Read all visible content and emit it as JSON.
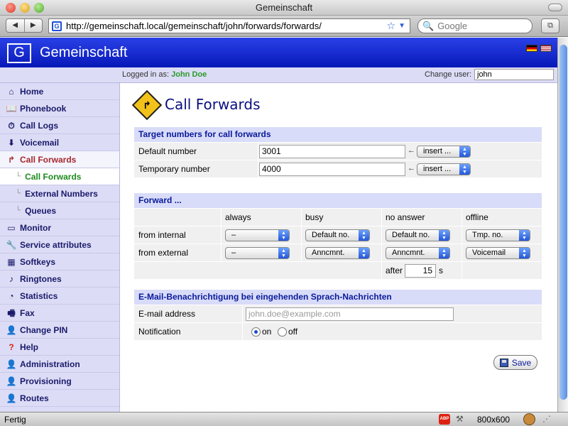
{
  "window": {
    "title": "Gemeinschaft"
  },
  "browser": {
    "url": "http://gemeinschaft.local/gemeinschaft/john/forwards/forwards/",
    "back": "◀",
    "forward": "▶",
    "search_placeholder": "Google"
  },
  "app": {
    "logo_glyph": "G",
    "title": "Gemeinschaft",
    "logged_in_label": "Logged in as:",
    "logged_in_user": "John Doe",
    "change_user_label": "Change user:",
    "change_user_value": "john"
  },
  "sidebar": {
    "items": [
      {
        "label": "Home",
        "icon": "home-icon"
      },
      {
        "label": "Phonebook",
        "icon": "phonebook-icon"
      },
      {
        "label": "Call Logs",
        "icon": "call-logs-icon"
      },
      {
        "label": "Voicemail",
        "icon": "voicemail-icon"
      },
      {
        "label": "Call Forwards",
        "icon": "call-forwards-icon"
      },
      {
        "label": "Call Forwards"
      },
      {
        "label": "External Numbers"
      },
      {
        "label": "Queues"
      },
      {
        "label": "Monitor",
        "icon": "monitor-icon"
      },
      {
        "label": "Service attributes",
        "icon": "wrench-icon"
      },
      {
        "label": "Softkeys",
        "icon": "softkeys-icon"
      },
      {
        "label": "Ringtones",
        "icon": "ringtones-icon"
      },
      {
        "label": "Statistics",
        "icon": "statistics-icon"
      },
      {
        "label": "Fax",
        "icon": "fax-icon"
      },
      {
        "label": "Change PIN",
        "icon": "change-pin-icon"
      },
      {
        "label": "Help",
        "icon": "help-icon"
      },
      {
        "label": "Administration",
        "icon": "administration-icon"
      },
      {
        "label": "Provisioning",
        "icon": "provisioning-icon"
      },
      {
        "label": "Routes",
        "icon": "routes-icon"
      }
    ]
  },
  "page": {
    "title": "Call Forwards"
  },
  "targets": {
    "heading": "Target numbers for call forwards",
    "default_label": "Default number",
    "default_value": "3001",
    "temporary_label": "Temporary number",
    "temporary_value": "4000",
    "insert_label": "insert ..."
  },
  "forward": {
    "heading": "Forward ...",
    "columns": [
      "always",
      "busy",
      "no answer",
      "offline"
    ],
    "rows": [
      {
        "label": "from internal",
        "values": [
          "–",
          "Default no.",
          "Default no.",
          "Tmp. no."
        ]
      },
      {
        "label": "from external",
        "values": [
          "–",
          "Anncmnt.",
          "Anncmnt.",
          "Voicemail"
        ]
      }
    ],
    "after_label": "after",
    "after_value": "15",
    "after_unit": "s"
  },
  "email": {
    "heading": "E-Mail-Benachrichtigung bei eingehenden Sprach-Nachrichten",
    "address_label": "E-mail address",
    "address_placeholder": "john.doe@example.com",
    "notification_label": "Notification",
    "on_label": "on",
    "off_label": "off"
  },
  "save_label": "Save",
  "status": {
    "text": "Fertig",
    "resolution": "800x600",
    "abp": "ABP"
  }
}
